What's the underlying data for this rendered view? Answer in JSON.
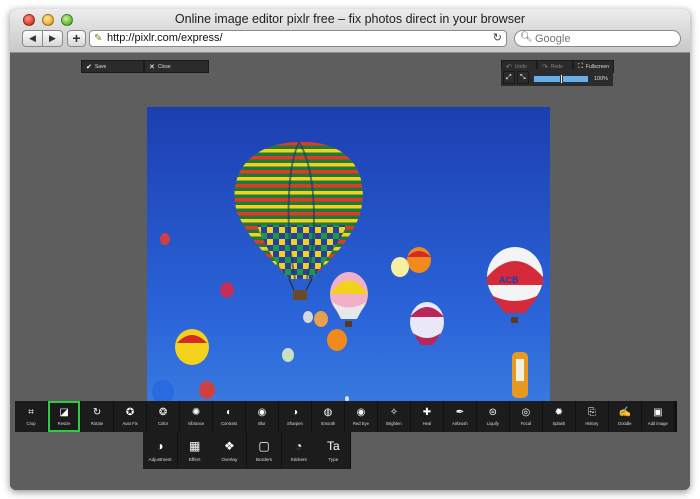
{
  "window": {
    "title": "Online image editor pixlr free – fix photos direct in your browser"
  },
  "browser": {
    "back_icon": "back-arrow-icon",
    "forward_icon": "forward-arrow-icon",
    "add_label": "+",
    "url": "http://pixlr.com/express/",
    "search_placeholder": "Google"
  },
  "editor": {
    "save_label": "Save",
    "close_label": "Close",
    "undo_label": "Undo",
    "redo_label": "Redo",
    "fullscreen_label": "Fullscreen",
    "zoom_value": "100%",
    "zoom_fraction": 0.5
  },
  "tools": [
    {
      "label": "Crop",
      "icon": "crop-icon"
    },
    {
      "label": "Resize",
      "icon": "resize-icon"
    },
    {
      "label": "Rotate",
      "icon": "rotate-icon"
    },
    {
      "label": "Auto Fix",
      "icon": "auto-fix-icon"
    },
    {
      "label": "Color",
      "icon": "color-icon"
    },
    {
      "label": "Vibrance",
      "icon": "vibrance-icon"
    },
    {
      "label": "Contrast",
      "icon": "contrast-icon"
    },
    {
      "label": "Blur",
      "icon": "blur-icon"
    },
    {
      "label": "Sharpen",
      "icon": "sharpen-icon"
    },
    {
      "label": "Smooth",
      "icon": "smooth-icon"
    },
    {
      "label": "Red Eye",
      "icon": "red-eye-icon"
    },
    {
      "label": "Brighten",
      "icon": "brighten-icon"
    },
    {
      "label": "Heal",
      "icon": "heal-icon"
    },
    {
      "label": "Airbrush",
      "icon": "airbrush-icon"
    },
    {
      "label": "Liquify",
      "icon": "liquify-icon"
    },
    {
      "label": "Focal",
      "icon": "focal-icon"
    },
    {
      "label": "Splash",
      "icon": "splash-icon"
    },
    {
      "label": "History",
      "icon": "history-icon"
    },
    {
      "label": "Doodle",
      "icon": "doodle-icon"
    },
    {
      "label": "Add image",
      "icon": "add-image-icon"
    }
  ],
  "categories": [
    {
      "label": "Adjustment",
      "icon": "adjustment-icon"
    },
    {
      "label": "Effect",
      "icon": "effect-icon"
    },
    {
      "label": "Overlay",
      "icon": "overlay-icon"
    },
    {
      "label": "Borders",
      "icon": "borders-icon"
    },
    {
      "label": "Stickers",
      "icon": "stickers-icon"
    },
    {
      "label": "Type",
      "icon": "type-icon"
    }
  ],
  "colors": {
    "accent": "#2ecc40",
    "sky": "#2a63d8",
    "chrome": "#5e5e5e"
  }
}
